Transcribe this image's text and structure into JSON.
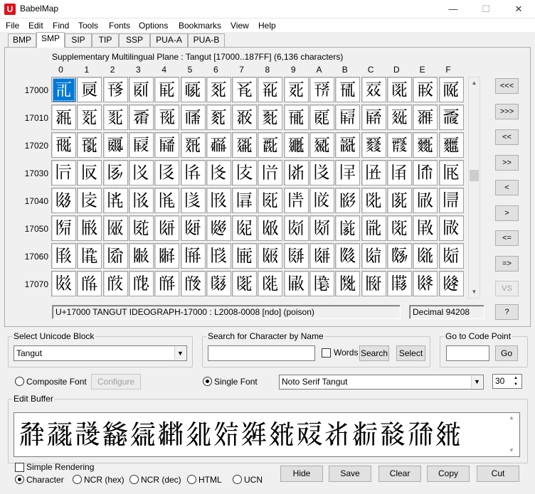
{
  "window": {
    "title": "BabelMap",
    "icon_letter": "U",
    "minimize": "—",
    "maximize": "☐",
    "close": "✕"
  },
  "menu": [
    "File",
    "Edit",
    "Find",
    "Tools",
    "Fonts",
    "Options",
    "Bookmarks",
    "View",
    "Help"
  ],
  "tabs": [
    "BMP",
    "SMP",
    "SIP",
    "TIP",
    "SSP",
    "PUA-A",
    "PUA-B"
  ],
  "active_tab": "SMP",
  "plane_label": "Supplementary Multilingual Plane : Tangut [17000..187FF] (6,136 characters)",
  "column_headers": [
    "0",
    "1",
    "2",
    "3",
    "4",
    "5",
    "6",
    "7",
    "8",
    "9",
    "A",
    "B",
    "C",
    "D",
    "E",
    "F"
  ],
  "row_headers": [
    "17000",
    "17010",
    "17020",
    "17030",
    "17040",
    "17050",
    "17060",
    "17070"
  ],
  "grid_rows": [
    [
      "𗀀",
      "𗀁",
      "𗀂",
      "𗀃",
      "𗀄",
      "𗀅",
      "𗀆",
      "𗀇",
      "𗀈",
      "𗀉",
      "𗀊",
      "𗀋",
      "𗀌",
      "𗀍",
      "𗀎",
      "𗀏"
    ],
    [
      "𗀐",
      "𗀑",
      "𗀒",
      "𗀓",
      "𗀔",
      "𗀕",
      "𗀖",
      "𗀗",
      "𗀘",
      "𗀙",
      "𗀚",
      "𗀛",
      "𗀜",
      "𗀝",
      "𗀞",
      "𗀟"
    ],
    [
      "𗀠",
      "𗀡",
      "𗀢",
      "𗀣",
      "𗀤",
      "𗀥",
      "𗀦",
      "𗀧",
      "𗀨",
      "𗀩",
      "𗀪",
      "𗀫",
      "𗀬",
      "𗀭",
      "𗀮",
      "𗀯"
    ],
    [
      "𗀰",
      "𗀱",
      "𗀲",
      "𗀳",
      "𗀴",
      "𗀵",
      "𗀶",
      "𗀷",
      "𗀸",
      "𗀹",
      "𗀺",
      "𗀻",
      "𗀼",
      "𗀽",
      "𗀾",
      "𗀿"
    ],
    [
      "𗁀",
      "𗁁",
      "𗁂",
      "𗁃",
      "𗁄",
      "𗁅",
      "𗁆",
      "𗁇",
      "𗁈",
      "𗁉",
      "𗁊",
      "𗁋",
      "𗁌",
      "𗁍",
      "𗁎",
      "𗁏"
    ],
    [
      "𗁐",
      "𗁑",
      "𗁒",
      "𗁓",
      "𗁔",
      "𗁕",
      "𗁖",
      "𗁗",
      "𗁘",
      "𗁙",
      "𗁚",
      "𗁛",
      "𗁜",
      "𗁝",
      "𗁞",
      "𗁟"
    ],
    [
      "𗁠",
      "𗁡",
      "𗁢",
      "𗁣",
      "𗁤",
      "𗁥",
      "𗁦",
      "𗁧",
      "𗁨",
      "𗁩",
      "𗁪",
      "𗁫",
      "𗁬",
      "𗁭",
      "𗁮",
      "𗁯"
    ],
    [
      "𗁰",
      "𗁱",
      "𗁲",
      "𗁳",
      "𗁴",
      "𗁵",
      "𗁶",
      "𗁷",
      "𗁸",
      "𗁹",
      "𗁺",
      "𗁻",
      "𗁼",
      "𗁽",
      "𗁾",
      "𗁿"
    ]
  ],
  "nav_buttons": [
    "<<<",
    ">>>",
    "<<",
    ">>",
    "<",
    ">",
    "<=",
    "=>",
    "VS",
    "?"
  ],
  "char_info": "U+17000 TANGUT IDEOGRAPH-17000 : L2008-0008 [ndo] (poison)",
  "decimal_info": "Decimal 94208",
  "unicode_block": {
    "label": "Select Unicode Block",
    "value": "Tangut"
  },
  "search": {
    "label": "Search for Character by Name",
    "value": "",
    "words_label": "Words",
    "search_button": "Search",
    "select_button": "Select"
  },
  "goto": {
    "label": "Go to Code Point",
    "value": "",
    "go_button": "Go"
  },
  "font_options": {
    "composite_label": "Composite Font",
    "configure_button": "Configure",
    "single_label": "Single Font",
    "font_value": "Noto Serif Tangut",
    "size_value": "30"
  },
  "edit_buffer": {
    "label": "Edit Buffer",
    "text": "𗴂𗹙𘄍𗴮𗦇𘂤𗢭𗼻𘂸𗾫𗠝𘂆𘂊𘈷𗗙𗾫"
  },
  "bottom": {
    "simple_rendering": "Simple Rendering",
    "formats": [
      "Character",
      "NCR (hex)",
      "NCR (dec)",
      "HTML",
      "UCN"
    ],
    "selected_format": "Character",
    "hide": "Hide",
    "save": "Save",
    "clear": "Clear",
    "copy": "Copy",
    "cut": "Cut"
  }
}
